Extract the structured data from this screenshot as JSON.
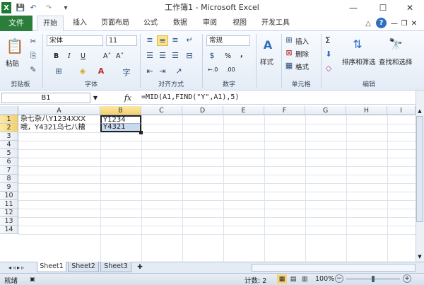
{
  "window": {
    "title": "工作簿1 - Microsoft Excel",
    "minimize": "—",
    "maximize": "☐",
    "close": "✕"
  },
  "qat": {
    "app_icon": "X",
    "save": "💾",
    "undo": "↶",
    "redo": "↷",
    "customize": "▾"
  },
  "tabs": [
    {
      "label": "文件"
    },
    {
      "label": "开始"
    },
    {
      "label": "插入"
    },
    {
      "label": "页面布局"
    },
    {
      "label": "公式"
    },
    {
      "label": "数据"
    },
    {
      "label": "审阅"
    },
    {
      "label": "视图"
    },
    {
      "label": "开发工具"
    }
  ],
  "ribbon": {
    "clipboard": {
      "paste": "粘贴",
      "group": "剪贴板"
    },
    "font": {
      "name": "宋体",
      "size": "11",
      "bold": "B",
      "italic": "I",
      "underline": "U",
      "grow": "A˄",
      "shrink": "A˅",
      "group": "字体"
    },
    "align": {
      "group": "对齐方式"
    },
    "number": {
      "format": "常规",
      "percent": "%",
      "comma": ",",
      "inc": "←.0",
      "dec": ".00",
      "group": "数字"
    },
    "styles": {
      "label": "样式"
    },
    "cells": {
      "insert": "插入",
      "delete": "删除",
      "format": "格式",
      "group": "单元格"
    },
    "editing": {
      "sigma": "Σ",
      "sort": "排序和筛选",
      "find": "查找和选择",
      "group": "编辑"
    }
  },
  "formula_bar": {
    "namebox": "B1",
    "fx": "fx",
    "formula": "=MID(A1,FIND(\"Y\",A1),5)"
  },
  "columns": [
    "A",
    "B",
    "C",
    "D",
    "E",
    "F",
    "G",
    "H",
    "I"
  ],
  "rows": [
    "1",
    "2",
    "3",
    "4",
    "5",
    "6",
    "7",
    "8",
    "9",
    "10",
    "11",
    "12",
    "13",
    "14"
  ],
  "cells": {
    "A1": "杂七杂八Y1234XXX",
    "A2": "哦，Y4321乌七八糟",
    "B1": "Y1234",
    "B2": "Y4321"
  },
  "sheets": [
    "Sheet1",
    "Sheet2",
    "Sheet3"
  ],
  "status": {
    "mode": "就绪",
    "count": "计数: 2",
    "zoom": "100%",
    "minus": "−",
    "plus": "+"
  }
}
